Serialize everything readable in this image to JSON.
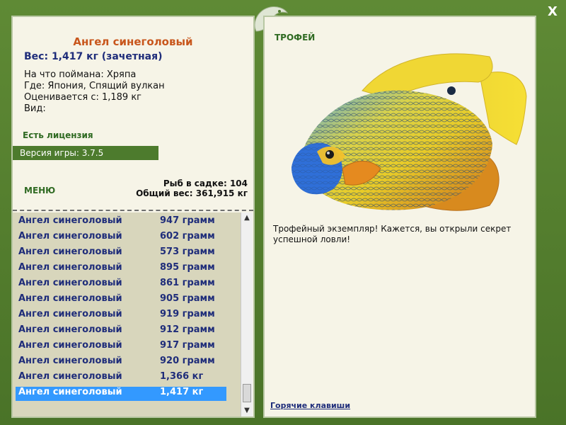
{
  "window": {
    "close_label": "X"
  },
  "left": {
    "title": "Ангел синеголовый",
    "weight": "Вес: 1,417 кг (зачетная)",
    "caught_on": "На что поймана: Хряпа",
    "where": "Где: Япония, Спящий вулкан",
    "rated_from": "Оценивается с: 1,189 кг",
    "kind": "Вид:",
    "license": "Есть лицензия",
    "version": "Версия игры: 3.7.5",
    "menu": "МЕНЮ",
    "stats": {
      "in_cage": "Рыб в садке: 104",
      "total_weight": "Общий вес: 361,915 кг"
    },
    "list": [
      {
        "name": "Ангел синеголовый",
        "weight": "947 грамм"
      },
      {
        "name": "Ангел синеголовый",
        "weight": "602 грамм"
      },
      {
        "name": "Ангел синеголовый",
        "weight": "573 грамм"
      },
      {
        "name": "Ангел синеголовый",
        "weight": "895 грамм"
      },
      {
        "name": "Ангел синеголовый",
        "weight": "861 грамм"
      },
      {
        "name": "Ангел синеголовый",
        "weight": "905 грамм"
      },
      {
        "name": "Ангел синеголовый",
        "weight": "919 грамм"
      },
      {
        "name": "Ангел синеголовый",
        "weight": "912 грамм"
      },
      {
        "name": "Ангел синеголовый",
        "weight": "917 грамм"
      },
      {
        "name": "Ангел синеголовый",
        "weight": "920 грамм"
      },
      {
        "name": "Ангел синеголовый",
        "weight": "1,366 кг"
      },
      {
        "name": "Ангел синеголовый",
        "weight": "1,417 кг"
      }
    ],
    "selected_index": 11
  },
  "right": {
    "trophy": "ТРОФЕЙ",
    "text": "Трофейный экземпляр! Кажется, вы открыли секрет успешной ловли!",
    "hotkeys": "Горячие клавиши",
    "fish_icon": "blueface-angelfish-image"
  },
  "colors": {
    "frame_green": "#4f7a2f",
    "panel_bg": "#f6f4e7",
    "title_orange": "#c8561c",
    "text_blue": "#1f2d7a",
    "label_green": "#2f6a22",
    "selection_blue": "#3399ff",
    "list_bg": "#d8d6bc"
  }
}
